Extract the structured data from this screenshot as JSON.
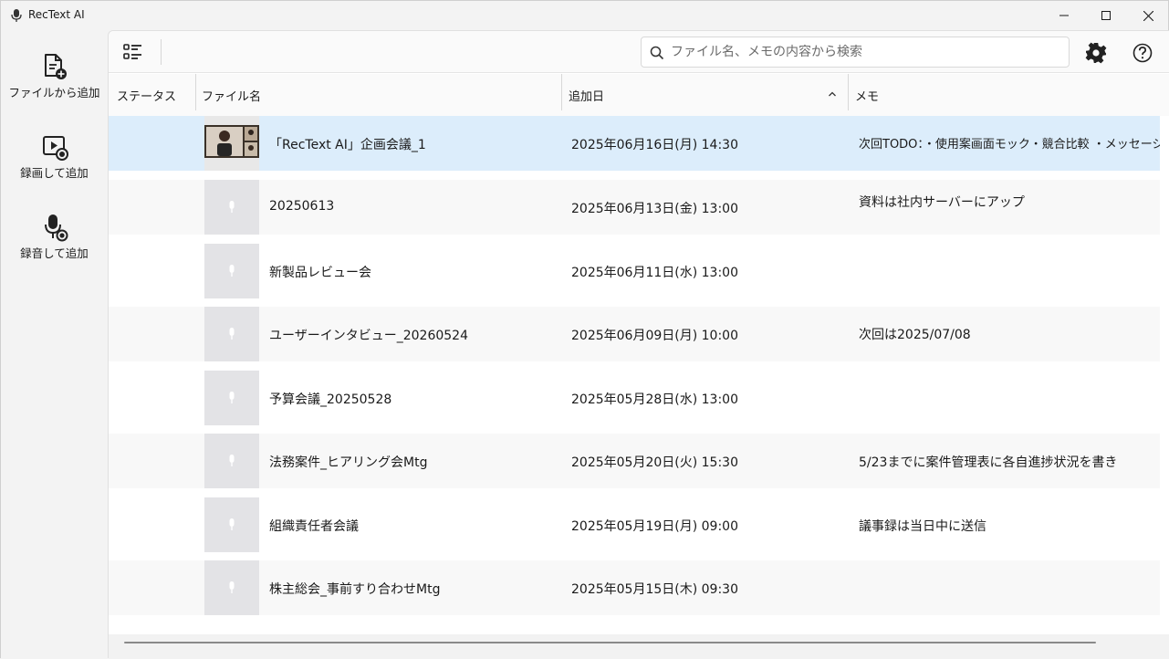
{
  "window": {
    "title": "RecText AI"
  },
  "sidebar": {
    "items": [
      {
        "label": "ファイルから追加",
        "icon": "file-add-icon"
      },
      {
        "label": "録画して追加",
        "icon": "video-record-icon"
      },
      {
        "label": "録音して追加",
        "icon": "mic-record-icon"
      }
    ]
  },
  "toolbar": {
    "search_placeholder": "ファイル名、メモの内容から検索",
    "icons": [
      "list-view-icon",
      "search-icon",
      "gear-icon",
      "help-icon"
    ]
  },
  "table": {
    "columns": [
      "ステータス",
      "ファイル名",
      "追加日",
      "メモ"
    ],
    "sort": {
      "column": "追加日",
      "direction": "ascending-indicator"
    },
    "rows": [
      {
        "status": "",
        "name": "「RecText AI」企画会議_1",
        "date": "2025年06月16日(月) 14:30",
        "memo": "次回TODO：・使用案画面モック・競合比較 ・メッセージ",
        "thumbnail": "video",
        "selected": true
      },
      {
        "status": "",
        "name": "20250613",
        "date": "2025年06月13日(金) 13:00",
        "memo": "資料は社内サーバーにアップ",
        "thumbnail": "audio"
      },
      {
        "status": "",
        "name": "新製品レビュー会",
        "date": "2025年06月11日(水) 13:00",
        "memo": "",
        "thumbnail": "audio"
      },
      {
        "status": "",
        "name": "ユーザーインタビュー_20260524",
        "date": "2025年06月09日(月) 10:00",
        "memo": "次回は2025/07/08",
        "thumbnail": "audio"
      },
      {
        "status": "",
        "name": "予算会議_20250528",
        "date": "2025年05月28日(水) 13:00",
        "memo": "",
        "thumbnail": "audio"
      },
      {
        "status": "",
        "name": "法務案件_ヒアリング会Mtg",
        "date": "2025年05月20日(火) 15:30",
        "memo": "5/23までに案件管理表に各自進捗状況を書き",
        "thumbnail": "audio"
      },
      {
        "status": "",
        "name": "組織責任者会議",
        "date": "2025年05月19日(月) 09:00",
        "memo": "議事録は当日中に送信",
        "thumbnail": "audio"
      },
      {
        "status": "",
        "name": "株主総会_事前すり合わせMtg",
        "date": "2025年05月15日(木) 09:30",
        "memo": "",
        "thumbnail": "audio"
      }
    ]
  },
  "colors": {
    "selected_row": "#dcedfb",
    "thumbnail_bg": "#e3e3e6"
  }
}
